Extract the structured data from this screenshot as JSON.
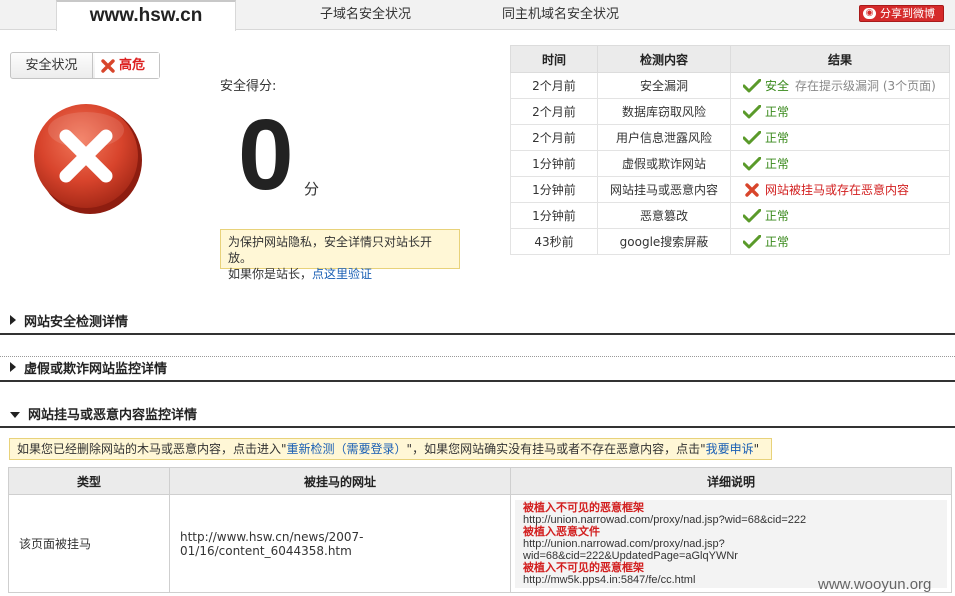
{
  "tabs": {
    "main": "www.hsw.cn",
    "subdomain": "子域名安全状况",
    "same_host": "同主机域名安全状况",
    "share": "分享到微博"
  },
  "status": {
    "label": "安全状况",
    "value": "高危"
  },
  "score": {
    "label": "安全得分:",
    "value": "0",
    "unit": "分"
  },
  "notice": {
    "text": "为保护网站隐私，安全详情只对站长开放。",
    "text2": "如果你是站长，",
    "link": "点这里验证"
  },
  "results": {
    "headers": [
      "时间",
      "检测内容",
      "结果"
    ],
    "rows": [
      {
        "time": "2个月前",
        "item": "安全漏洞",
        "result": "安全",
        "hint": "存在提示级漏洞 (3个页面)",
        "status": "ok"
      },
      {
        "time": "2个月前",
        "item": "数据库窃取风险",
        "result": "正常",
        "hint": "",
        "status": "ok"
      },
      {
        "time": "2个月前",
        "item": "用户信息泄露风险",
        "result": "正常",
        "hint": "",
        "status": "ok"
      },
      {
        "time": "1分钟前",
        "item": "虚假或欺诈网站",
        "result": "正常",
        "hint": "",
        "status": "ok"
      },
      {
        "time": "1分钟前",
        "item": "网站挂马或恶意内容",
        "result": "网站被挂马或存在恶意内容",
        "hint": "",
        "status": "bad"
      },
      {
        "time": "1分钟前",
        "item": "恶意篡改",
        "result": "正常",
        "hint": "",
        "status": "ok"
      },
      {
        "time": "43秒前",
        "item": "google搜索屏蔽",
        "result": "正常",
        "hint": "",
        "status": "ok"
      }
    ]
  },
  "sections": {
    "s1": "网站安全检测详情",
    "s2": "虚假或欺诈网站监控详情",
    "s3": "网站挂马或恶意内容监控详情"
  },
  "info_bar": {
    "pre": "如果您已经删除网站的木马或恶意内容，点击进入\"",
    "link1": "重新检测（需要登录）",
    "mid": "\"，如果您网站确实没有挂马或者不存在恶意内容，点击\"",
    "link2": "我要申诉",
    "post": "\""
  },
  "detail_table": {
    "headers": [
      "类型",
      "被挂马的网址",
      "详细说明"
    ],
    "row": {
      "type": "该页面被挂马",
      "url": "http://www.hsw.cn/news/2007-01/16/content_6044358.htm",
      "details": [
        {
          "title": "被植入不可见的恶意框架",
          "url": "http://union.narrowad.com/proxy/nad.jsp?wid=68&cid=222"
        },
        {
          "title": "被植入恶意文件",
          "url": "http://union.narrowad.com/proxy/nad.jsp?",
          "url2": "wid=68&cid=222&UpdatedPage=aGlqYWNr"
        },
        {
          "title": "被植入不可见的恶意框架",
          "url": "http://mw5k.pps4.in:5847/fe/cc.html"
        }
      ]
    }
  },
  "watermark": "www.wooyun.org",
  "colors": {
    "danger": "#d21f1f",
    "ok": "#3a8a1c",
    "link": "#1a5fb4"
  }
}
